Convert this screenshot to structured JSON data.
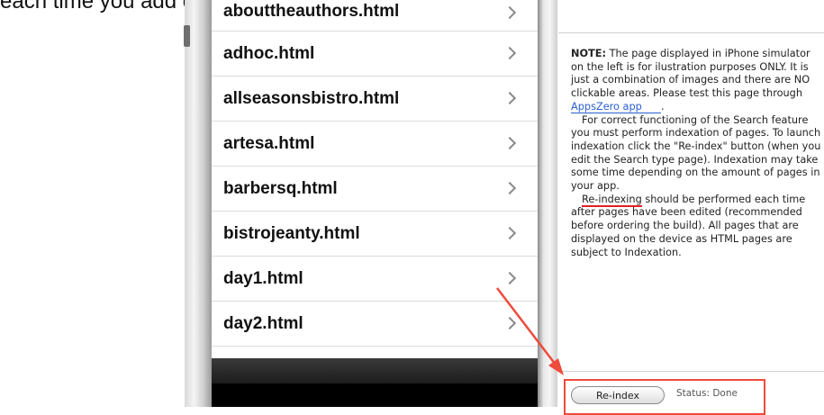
{
  "caption": "each time you add or edit any pages within your app.",
  "pages": [
    "abouttheauthors.html",
    "adhoc.html",
    "allseasonsbistro.html",
    "artesa.html",
    "barbersq.html",
    "bistrojeanty.html",
    "day1.html",
    "day2.html"
  ],
  "note": {
    "label": "NOTE:",
    "text_1": " The page displayed in iPhone simulator on the left is for ilustration purposes ONLY. It is just a combination of images and there are NO clickable areas. Please test this page through ",
    "link": "AppsZero",
    "link_tail": " app",
    "text_1_end": ".",
    "para_2": "For correct functioning of the Search feature you must perform indexation of pages. To launch indexation click the \"Re-index\" button (when you edit the Search type page). Indexation may take some time depending on the amount of pages in your app.",
    "reindexing_word": "Re-indexing",
    "para_3": " should be performed each time after pages have been edited (recommended before ordering the build). All pages that are displayed on the device as HTML pages are subject to Indexation."
  },
  "reindex_button": "Re-index",
  "status": "Status: Done",
  "colors": {
    "highlight": "#ee4b3c",
    "link": "#2a5fd0"
  }
}
